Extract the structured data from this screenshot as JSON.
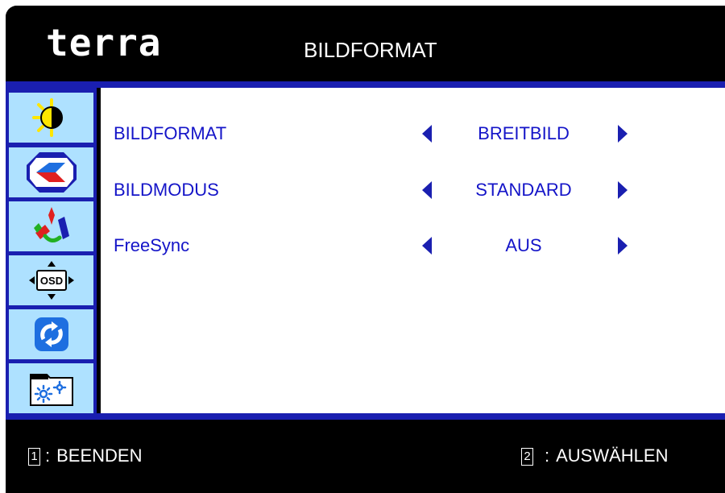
{
  "header": {
    "logo": "terra",
    "title": "BILDFORMAT"
  },
  "sidebar": {
    "items": [
      {
        "icon": "brightness-contrast-icon"
      },
      {
        "icon": "picture-format-icon",
        "selected": true
      },
      {
        "icon": "color-settings-icon"
      },
      {
        "icon": "osd-settings-icon"
      },
      {
        "icon": "reset-icon"
      },
      {
        "icon": "setup-icon"
      }
    ]
  },
  "settings": [
    {
      "label": "BILDFORMAT",
      "value": "BREITBILD"
    },
    {
      "label": "BILDMODUS",
      "value": "STANDARD"
    },
    {
      "label": "FreeSync",
      "value": "AUS"
    }
  ],
  "footer": {
    "key1_num": "1",
    "key1_sep": ":",
    "key1_label": "BEENDEN",
    "key2_num": "2",
    "key2_sep": ":",
    "key2_label": "AUSWÄHLEN"
  },
  "colors": {
    "accent": "#1a1fb0",
    "tile": "#aee1ff",
    "text": "#1414c8"
  }
}
